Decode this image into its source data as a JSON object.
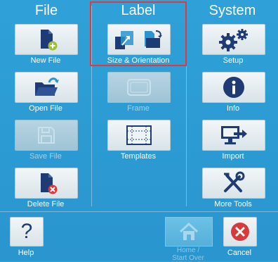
{
  "columns": {
    "file": "File",
    "label": "Label",
    "system": "System"
  },
  "file_menu": [
    {
      "label": "New File",
      "icon": "new-file-icon",
      "enabled": true
    },
    {
      "label": "Open File",
      "icon": "open-file-icon",
      "enabled": true
    },
    {
      "label": "Save File",
      "icon": "save-file-icon",
      "enabled": false
    },
    {
      "label": "Delete File",
      "icon": "delete-file-icon",
      "enabled": true
    }
  ],
  "label_menu": [
    {
      "label": "Size & Orientation",
      "icon": "size-orientation-icon",
      "enabled": true,
      "selected": true
    },
    {
      "label": "Frame",
      "icon": "frame-icon",
      "enabled": false
    },
    {
      "label": "Templates",
      "icon": "templates-icon",
      "enabled": true
    }
  ],
  "system_menu": [
    {
      "label": "Setup",
      "icon": "gear-icon",
      "enabled": true
    },
    {
      "label": "Info",
      "icon": "info-icon",
      "enabled": true
    },
    {
      "label": "Import",
      "icon": "import-icon",
      "enabled": true
    },
    {
      "label": "More Tools",
      "icon": "tools-icon",
      "enabled": true
    }
  ],
  "bottom_bar": {
    "help": "Help",
    "home_line1": "Home /",
    "home_line2": "Start Over",
    "cancel": "Cancel"
  },
  "colors": {
    "background": "#2f9fd6",
    "icon_navy": "#1f3b73",
    "selection": "#e03a3a",
    "cancel_red": "#d63a3a"
  }
}
